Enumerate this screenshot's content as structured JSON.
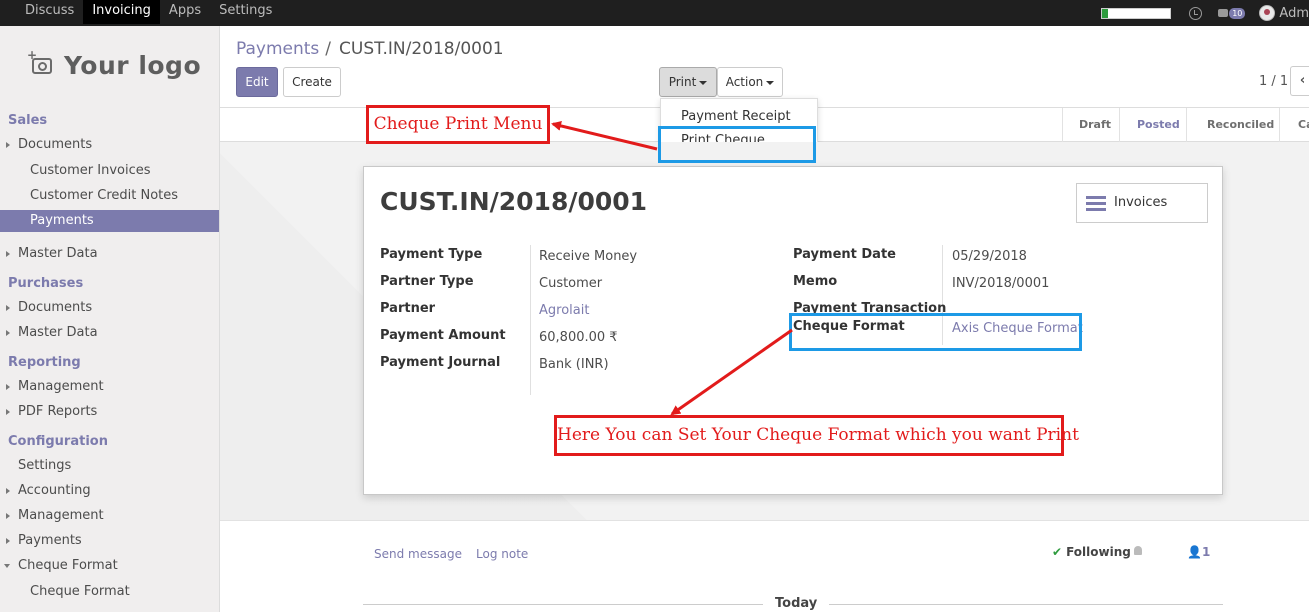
{
  "topbar": {
    "menu": [
      "Discuss",
      "Invoicing",
      "Apps",
      "Settings"
    ],
    "active_menu": "Invoicing",
    "message_count": "10",
    "username": "Adm",
    "progress_fraction": 0.08
  },
  "sidebar": {
    "logo_text": "Your logo",
    "items": [
      {
        "label": "Sales",
        "type": "head"
      },
      {
        "label": "Documents",
        "type": "l1",
        "caret": "right"
      },
      {
        "label": "Customer Invoices",
        "type": "l2"
      },
      {
        "label": "Customer Credit Notes",
        "type": "l2"
      },
      {
        "label": "Payments",
        "type": "l2",
        "active": true
      },
      {
        "label": "Master Data",
        "type": "l1",
        "caret": "right"
      },
      {
        "label": "Purchases",
        "type": "head"
      },
      {
        "label": "Documents",
        "type": "l1",
        "caret": "right"
      },
      {
        "label": "Master Data",
        "type": "l1",
        "caret": "right"
      },
      {
        "label": "Reporting",
        "type": "head"
      },
      {
        "label": "Management",
        "type": "l1",
        "caret": "right"
      },
      {
        "label": "PDF Reports",
        "type": "l1",
        "caret": "right"
      },
      {
        "label": "Configuration",
        "type": "head"
      },
      {
        "label": "Settings",
        "type": "l1"
      },
      {
        "label": "Accounting",
        "type": "l1",
        "caret": "right"
      },
      {
        "label": "Management",
        "type": "l1",
        "caret": "right"
      },
      {
        "label": "Payments",
        "type": "l1",
        "caret": "right"
      },
      {
        "label": "Cheque Format",
        "type": "l1",
        "caret": "down"
      },
      {
        "label": "Cheque Format",
        "type": "l2"
      }
    ]
  },
  "breadcrumb": {
    "parent": "Payments",
    "separator": "/",
    "current": "CUST.IN/2018/0001"
  },
  "buttons": {
    "edit": "Edit",
    "create": "Create",
    "print": "Print",
    "action": "Action"
  },
  "pager": {
    "text": "1 / 1",
    "prev": "‹"
  },
  "print_menu": {
    "items": [
      "Payment Receipt",
      "Print Cheque"
    ]
  },
  "statusbar": {
    "stages": [
      "Draft",
      "Posted",
      "Reconciled",
      "Ca"
    ],
    "active": "Posted"
  },
  "record": {
    "title": "CUST.IN/2018/0001",
    "smart_button": "Invoices",
    "left_fields": [
      {
        "label": "Payment Type",
        "value": "Receive Money",
        "link": false
      },
      {
        "label": "Partner Type",
        "value": "Customer",
        "link": false
      },
      {
        "label": "Partner",
        "value": "Agrolait",
        "link": true
      },
      {
        "label": "Payment Amount",
        "value": "60,800.00 ₹",
        "link": false
      },
      {
        "label": "Payment Journal",
        "value": "Bank (INR)",
        "link": false
      }
    ],
    "right_fields": [
      {
        "label": "Payment Date",
        "value": "05/29/2018",
        "link": false
      },
      {
        "label": "Memo",
        "value": "INV/2018/0001",
        "link": false
      },
      {
        "label": "Payment Transaction",
        "value": "",
        "link": false
      },
      {
        "label": "Cheque Format",
        "value": "Axis Cheque Format",
        "link": true
      }
    ]
  },
  "chatter": {
    "send_message": "Send message",
    "log_note": "Log note",
    "following": "Following",
    "followers": "1",
    "today": "Today"
  },
  "annotations": {
    "print_menu_callout": "Cheque Print Menu",
    "format_callout": "Here You can Set Your Cheque Format which you want Print"
  },
  "colors": {
    "accent": "#7c7bad",
    "annotation_red": "#e21b1b",
    "highlight_blue": "#1d9ae6"
  }
}
